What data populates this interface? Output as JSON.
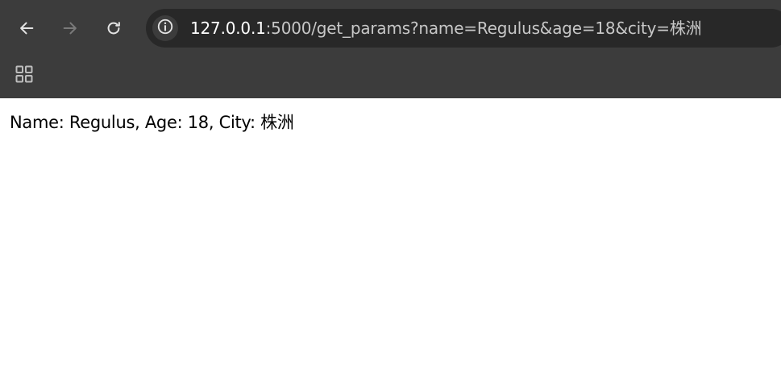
{
  "browser": {
    "toolbar": {
      "back_icon": "arrow-left-icon",
      "forward_icon": "arrow-right-icon",
      "reload_icon": "reload-icon",
      "site_info_icon": "info-circle-icon"
    },
    "address_bar": {
      "url_host": "127.0.0.1",
      "url_rest": ":5000/get_params?name=Regulus&age=18&city=株洲"
    },
    "bookmarks_bar": {
      "apps_icon": "apps-grid-icon"
    },
    "colors": {
      "chrome_bg": "#3c3c3c",
      "omnibox_bg": "#282828",
      "icon_active": "#e3e3e3",
      "icon_disabled": "#7a7a7a",
      "page_bg": "#ffffff"
    }
  },
  "page": {
    "body_text": "Name: Regulus, Age: 18, City: 株洲"
  }
}
